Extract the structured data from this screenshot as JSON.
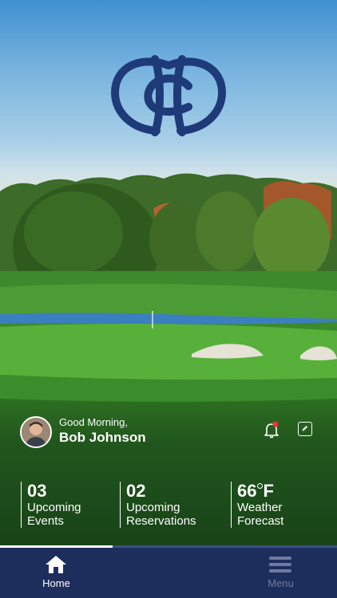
{
  "greeting": "Good Morning,",
  "user": {
    "name": "Bob Johnson"
  },
  "notifications": {
    "has_unread": true,
    "badge_color": "#e8323c"
  },
  "stats": [
    {
      "value": "03",
      "label_line1": "Upcoming",
      "label_line2": "Events"
    },
    {
      "value": "02",
      "label_line1": "Upcoming",
      "label_line2": "Reservations"
    },
    {
      "value": "66",
      "unit": "F",
      "label_line1": "Weather",
      "label_line2": "Forecast"
    }
  ],
  "progress": {
    "fraction": 0.333
  },
  "tabs": [
    {
      "label": "Home",
      "icon": "home-icon",
      "active": true
    },
    {
      "label": "Menu",
      "icon": "menu-icon",
      "active": false
    }
  ],
  "colors": {
    "navy": "#1d2d5c",
    "logo": "#1f3a78",
    "inactive_tab": "#6f7aa0"
  }
}
